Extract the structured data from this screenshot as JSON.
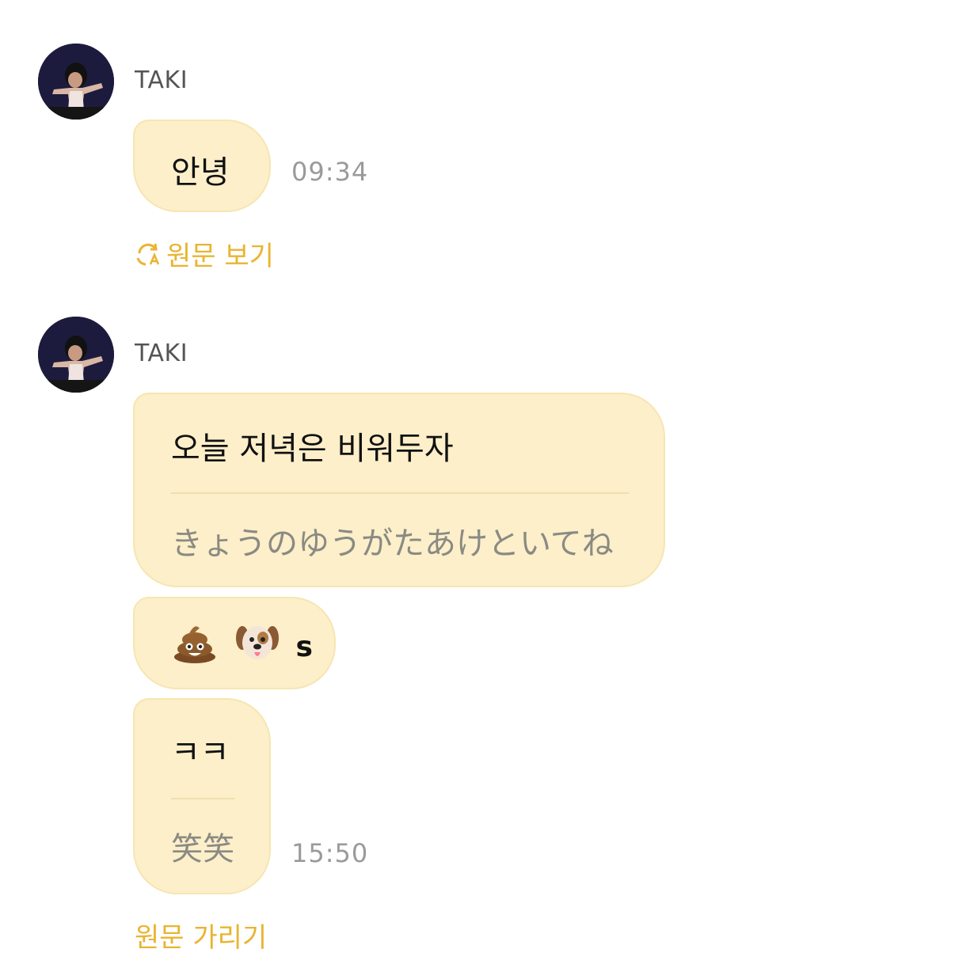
{
  "messages": [
    {
      "sender": "TAKI",
      "text": "안녕",
      "time": "09:34",
      "link": "원문 보기",
      "link_icon": "translate-icon"
    },
    {
      "sender": "TAKI",
      "text": "오늘 저녁은 비워두자",
      "translation": "きょうのゆうがたあけといてね"
    },
    {
      "emojis": [
        "pile-of-poo-emoji",
        "dog-face-emoji"
      ],
      "suffix": "s"
    },
    {
      "text": "ㅋㅋ",
      "translation": "笑笑",
      "time": "15:50",
      "link": "원문 가리기"
    }
  ],
  "colors": {
    "bubble": "#fcefc9",
    "bubble_border": "#f7e6b2",
    "link": "#e9b430",
    "time": "#9a9a9a"
  }
}
